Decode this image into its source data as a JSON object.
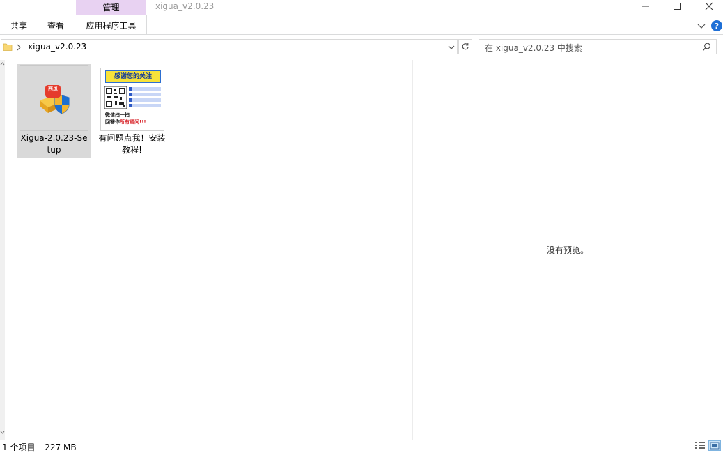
{
  "ribbon": {
    "manage_tab": "管理",
    "tabs": [
      "共享",
      "查看",
      "应用程序工具"
    ]
  },
  "window": {
    "title": "xigua_v2.0.23"
  },
  "address": {
    "path": "xigua_v2.0.23"
  },
  "search": {
    "placeholder": "在 xigua_v2.0.23 中搜索"
  },
  "files": [
    {
      "name": "Xigua-2.0.23-Setup",
      "icon": "installer-icon",
      "selected": true
    },
    {
      "name": "有问题点我！安装教程!",
      "icon": "image-thumbnail-icon",
      "selected": false
    }
  ],
  "thumbnail": {
    "banner": "感谢您的关注",
    "caption1": "微信扫一扫",
    "caption2_prefix": "回答你",
    "caption2_highlight": "所有疑问!!!"
  },
  "installer_badge": "西瓜",
  "preview": {
    "message": "没有预览。"
  },
  "status": {
    "items": "1 个项目",
    "size": "227 MB"
  },
  "colors": {
    "manage_tab_bg": "#e8d2f2",
    "help_blue": "#1e6fd6",
    "selection": "#d9d9d9",
    "folder_yellow": "#f8d775"
  }
}
